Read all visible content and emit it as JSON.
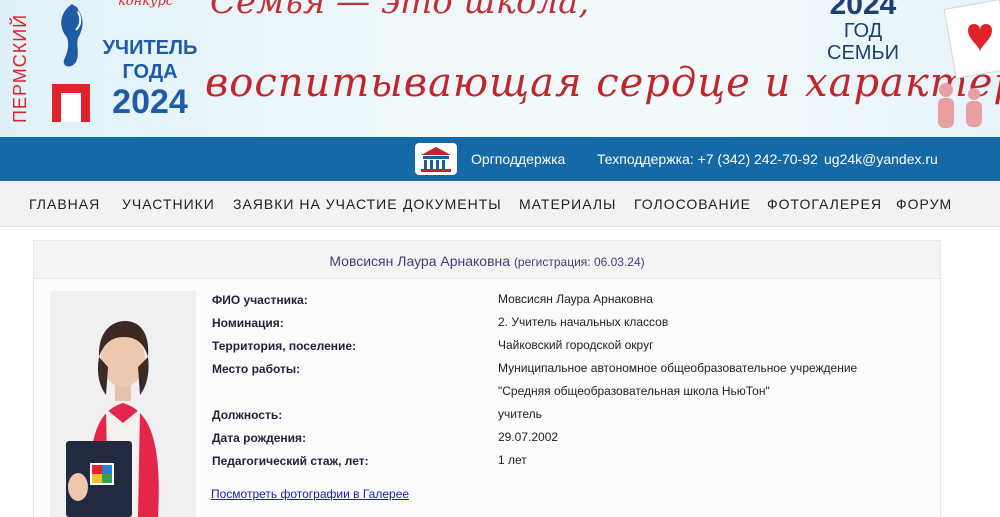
{
  "banner": {
    "vertical_text": "ПЕРМСКИЙ",
    "script_top": "конкурс",
    "logo_line1": "УЧИТЕЛЬ",
    "logo_line2": "ГОДА",
    "logo_year": "2024",
    "slogan_top": "Семья — это школа,",
    "slogan": "воспитывающая сердце и характер",
    "year_badge": "2024",
    "year_badge_caption": "ГОД СЕМЬИ"
  },
  "topbar": {
    "org_support": "Оргподдержка",
    "tech_support": "Техподдержка: +7 (342) 242-70-92",
    "email": "ug24k@yandex.ru"
  },
  "nav": {
    "items": [
      "ГЛАВНАЯ",
      "УЧАСТНИКИ",
      "ЗАЯВКИ НА УЧАСТИЕ",
      "ДОКУМЕНТЫ",
      "МАТЕРИАЛЫ",
      "ГОЛОСОВАНИЕ",
      "ФОТОГАЛЕРЕЯ",
      "ФОРУМ"
    ]
  },
  "participant": {
    "name_heading": "Мовсисян Лаура Арнаковна",
    "registration": "(регистрация: 06.03.24)",
    "fields": [
      {
        "label": "ФИО участника:",
        "value": "Мовсисян Лаура Арнаковна"
      },
      {
        "label": "Номинация:",
        "value": "2. Учитель начальных классов"
      },
      {
        "label": "Территория, поселение:",
        "value": "Чайковский городской округ"
      },
      {
        "label": "Место работы:",
        "value": "Муниципальное автономное общеобразовательное учреждение \"Средняя общеобразовательная школа НьюТон\""
      },
      {
        "label": "Должность:",
        "value": "учитель"
      },
      {
        "label": "Дата рождения:",
        "value": "29.07.2002"
      },
      {
        "label": "Педагогический стаж, лет:",
        "value": "1 лет"
      }
    ],
    "gallery_link": "Посмотреть фотографии в Галерее"
  },
  "colors": {
    "topbar": "#1569a6",
    "brand_red": "#c0262c",
    "brand_blue": "#1e5ca8",
    "link": "#1a21b8"
  }
}
